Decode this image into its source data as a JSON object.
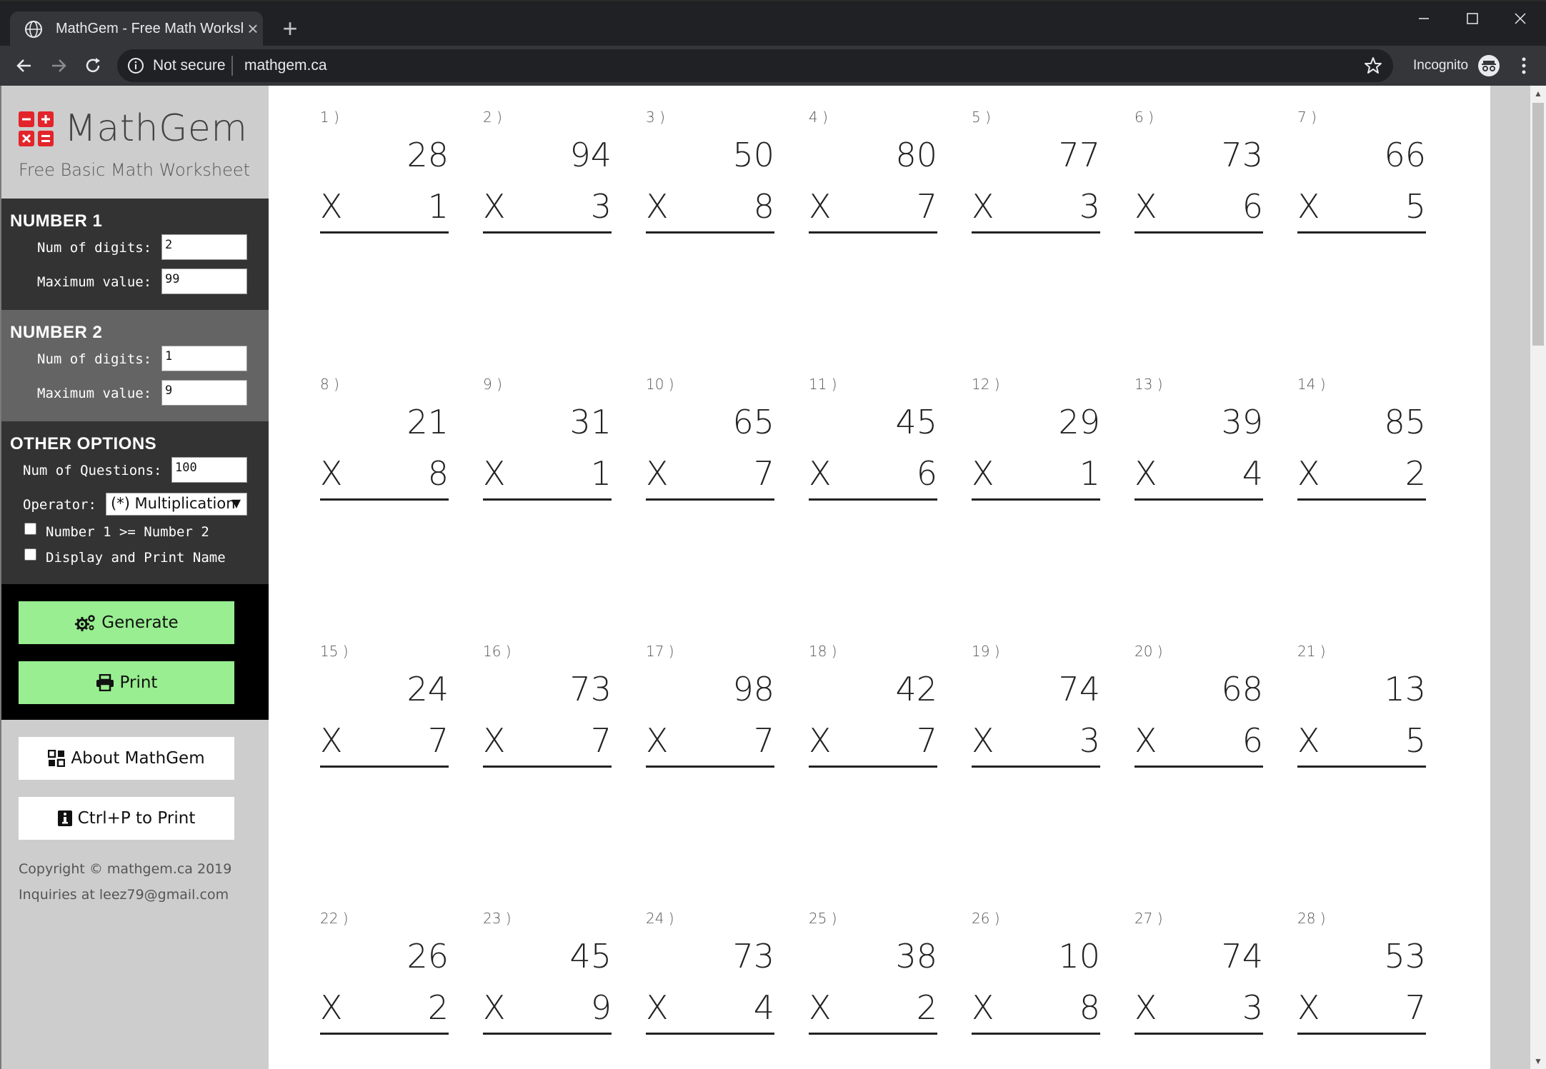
{
  "browser": {
    "tab_title": "MathGem - Free Math Worksheet",
    "security_label": "Not secure",
    "url": "mathgem.ca",
    "incognito_label": "Incognito"
  },
  "sidebar": {
    "logo_text": "MathGem",
    "subtitle": "Free Basic Math Worksheet",
    "number1": {
      "heading": "NUMBER 1",
      "digits_label": "Num of digits:",
      "digits_value": "2",
      "max_label": "Maximum value:",
      "max_value": "99"
    },
    "number2": {
      "heading": "NUMBER 2",
      "digits_label": "Num of digits:",
      "digits_value": "1",
      "max_label": "Maximum value:",
      "max_value": "9"
    },
    "options": {
      "heading": "OTHER OPTIONS",
      "questions_label": "Num of Questions:",
      "questions_value": "100",
      "operator_label": "Operator:",
      "operator_value": "(*) Multiplication",
      "check1_label": "Number 1 >= Number 2",
      "check2_label": "Display and Print Name"
    },
    "buttons": {
      "generate": "Generate",
      "print": "Print",
      "about": "About MathGem",
      "ctrlp": "Ctrl+P to Print"
    },
    "footer": {
      "copyright": "Copyright © mathgem.ca 2019",
      "inquiries": "Inquiries at leez79@gmail.com"
    }
  },
  "worksheet": {
    "operator_symbol": "X",
    "problems": [
      {
        "n": "1 )",
        "a": "28",
        "b": "1"
      },
      {
        "n": "2 )",
        "a": "94",
        "b": "3"
      },
      {
        "n": "3 )",
        "a": "50",
        "b": "8"
      },
      {
        "n": "4 )",
        "a": "80",
        "b": "7"
      },
      {
        "n": "5 )",
        "a": "77",
        "b": "3"
      },
      {
        "n": "6 )",
        "a": "73",
        "b": "6"
      },
      {
        "n": "7 )",
        "a": "66",
        "b": "5"
      },
      {
        "n": "8 )",
        "a": "21",
        "b": "8"
      },
      {
        "n": "9 )",
        "a": "31",
        "b": "1"
      },
      {
        "n": "10 )",
        "a": "65",
        "b": "7"
      },
      {
        "n": "11 )",
        "a": "45",
        "b": "6"
      },
      {
        "n": "12 )",
        "a": "29",
        "b": "1"
      },
      {
        "n": "13 )",
        "a": "39",
        "b": "4"
      },
      {
        "n": "14 )",
        "a": "85",
        "b": "2"
      },
      {
        "n": "15 )",
        "a": "24",
        "b": "7"
      },
      {
        "n": "16 )",
        "a": "73",
        "b": "7"
      },
      {
        "n": "17 )",
        "a": "98",
        "b": "7"
      },
      {
        "n": "18 )",
        "a": "42",
        "b": "7"
      },
      {
        "n": "19 )",
        "a": "74",
        "b": "3"
      },
      {
        "n": "20 )",
        "a": "68",
        "b": "6"
      },
      {
        "n": "21 )",
        "a": "13",
        "b": "5"
      },
      {
        "n": "22 )",
        "a": "26",
        "b": "2"
      },
      {
        "n": "23 )",
        "a": "45",
        "b": "9"
      },
      {
        "n": "24 )",
        "a": "73",
        "b": "4"
      },
      {
        "n": "25 )",
        "a": "38",
        "b": "2"
      },
      {
        "n": "26 )",
        "a": "10",
        "b": "8"
      },
      {
        "n": "27 )",
        "a": "74",
        "b": "3"
      },
      {
        "n": "28 )",
        "a": "53",
        "b": "7"
      }
    ]
  },
  "colors": {
    "panel_dark": "#333333",
    "panel_mid": "#646464",
    "button_green": "#98ee90",
    "logo_red": "#e3242b"
  }
}
